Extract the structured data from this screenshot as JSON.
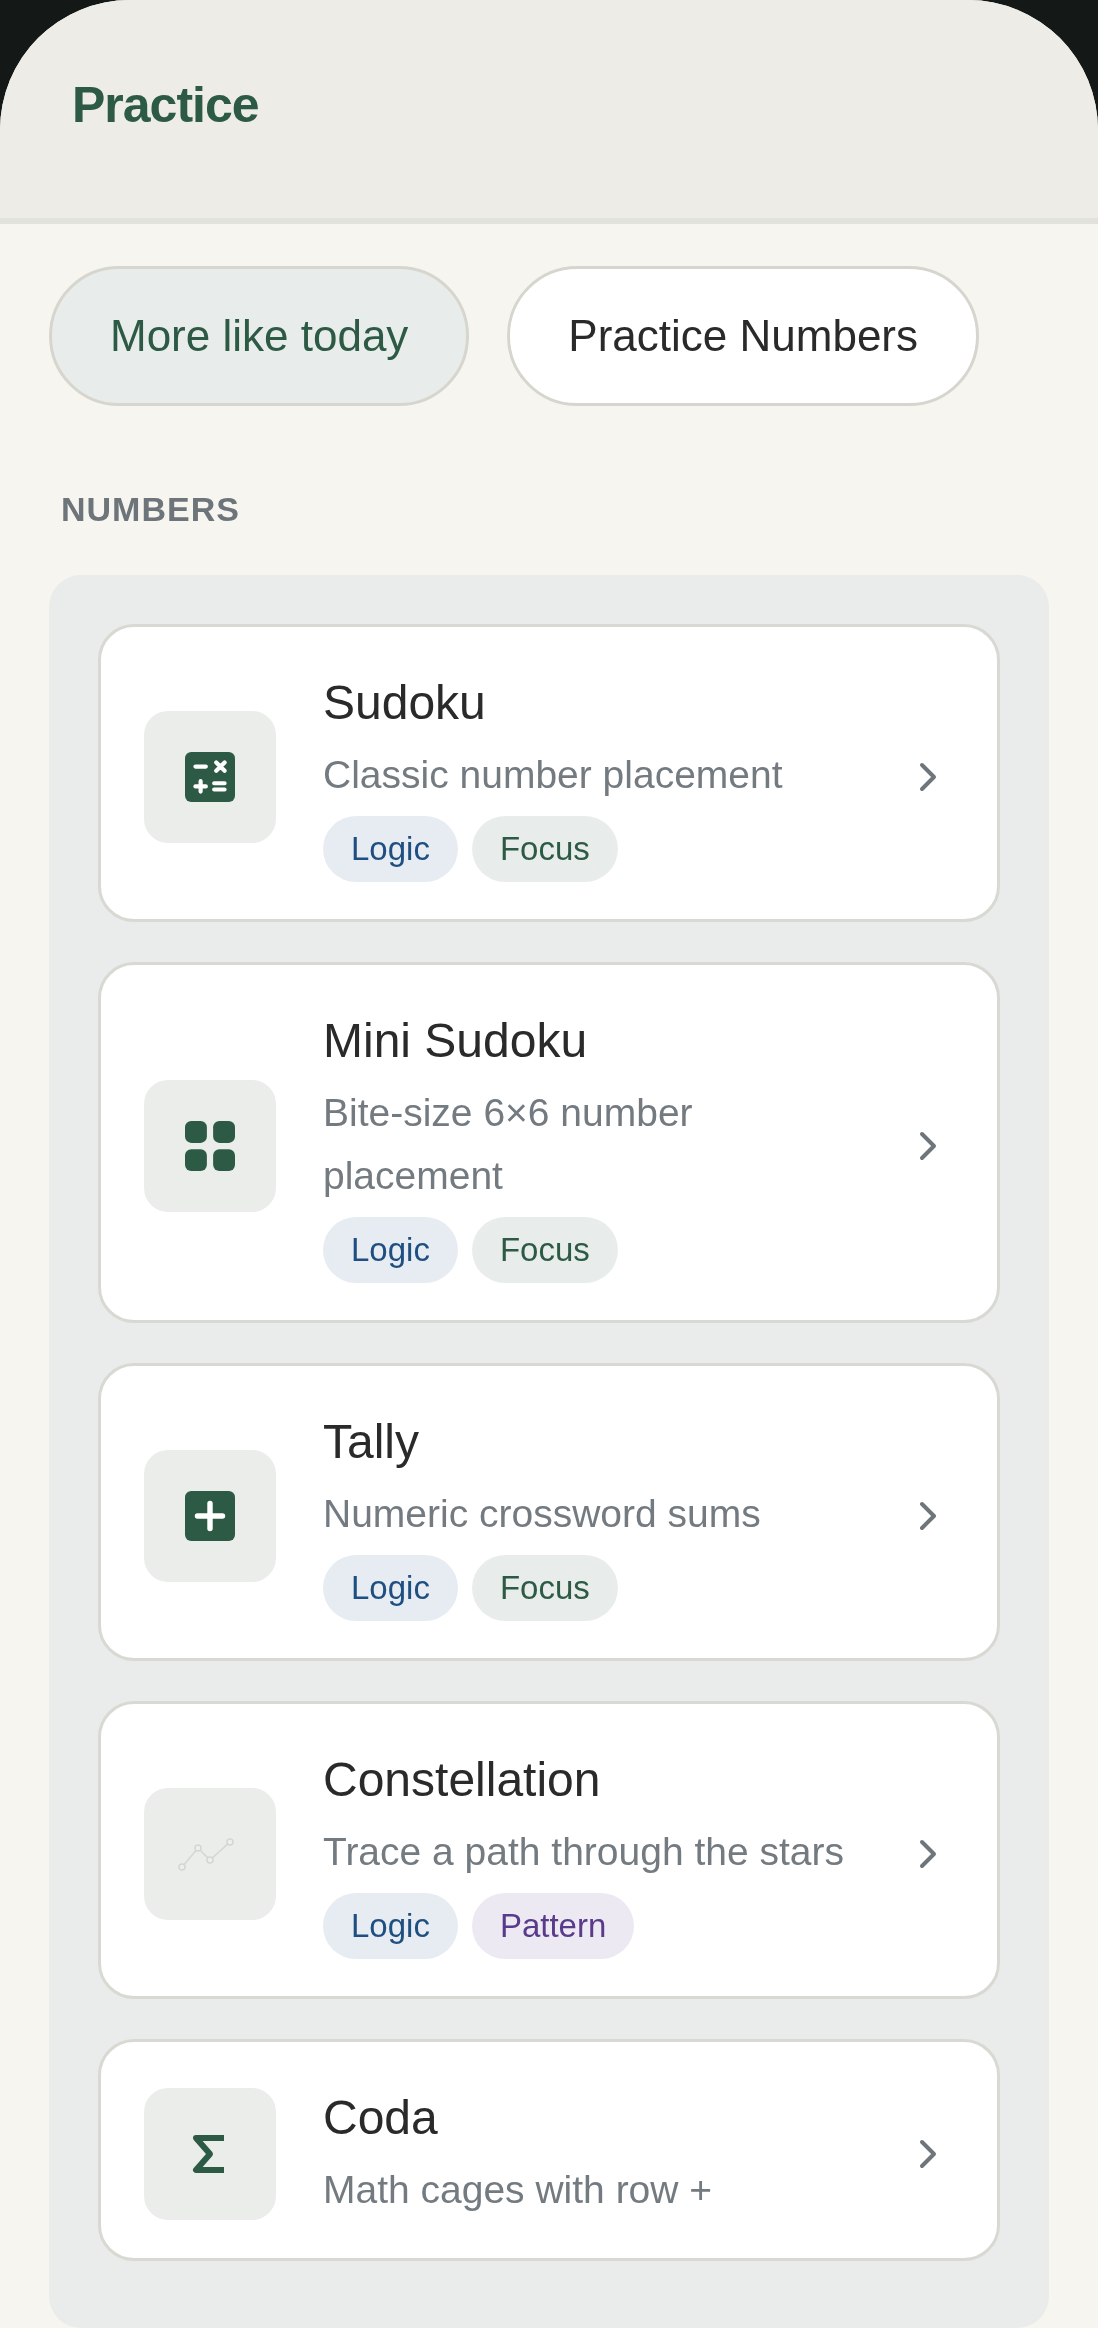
{
  "header": {
    "title": "Practice"
  },
  "chips": [
    {
      "label": "More like today",
      "selected": true
    },
    {
      "label": "Practice Numbers",
      "selected": false
    }
  ],
  "section": {
    "heading": "NUMBERS"
  },
  "games": [
    {
      "title": "Sudoku",
      "description": "Classic number placement",
      "tags": [
        {
          "label": "Logic",
          "color": "#1f4e80"
        },
        {
          "label": "Focus",
          "color": "#2d5a45"
        }
      ]
    },
    {
      "title": "Mini Sudoku",
      "description": "Bite-size 6×6 number placement",
      "tags": [
        {
          "label": "Logic",
          "color": "#1f4e80"
        },
        {
          "label": "Focus",
          "color": "#2d5a45"
        }
      ]
    },
    {
      "title": "Tally",
      "description": "Numeric crossword sums",
      "tags": [
        {
          "label": "Logic",
          "color": "#1f4e80"
        },
        {
          "label": "Focus",
          "color": "#2d5a45"
        }
      ]
    },
    {
      "title": "Constellation",
      "description": "Trace a path through the stars",
      "tags": [
        {
          "label": "Logic",
          "color": "#1f4e80"
        },
        {
          "label": "Pattern",
          "color": "#5a3a8a"
        }
      ]
    },
    {
      "title": "Coda",
      "description": "Math cages with row +"
    }
  ]
}
